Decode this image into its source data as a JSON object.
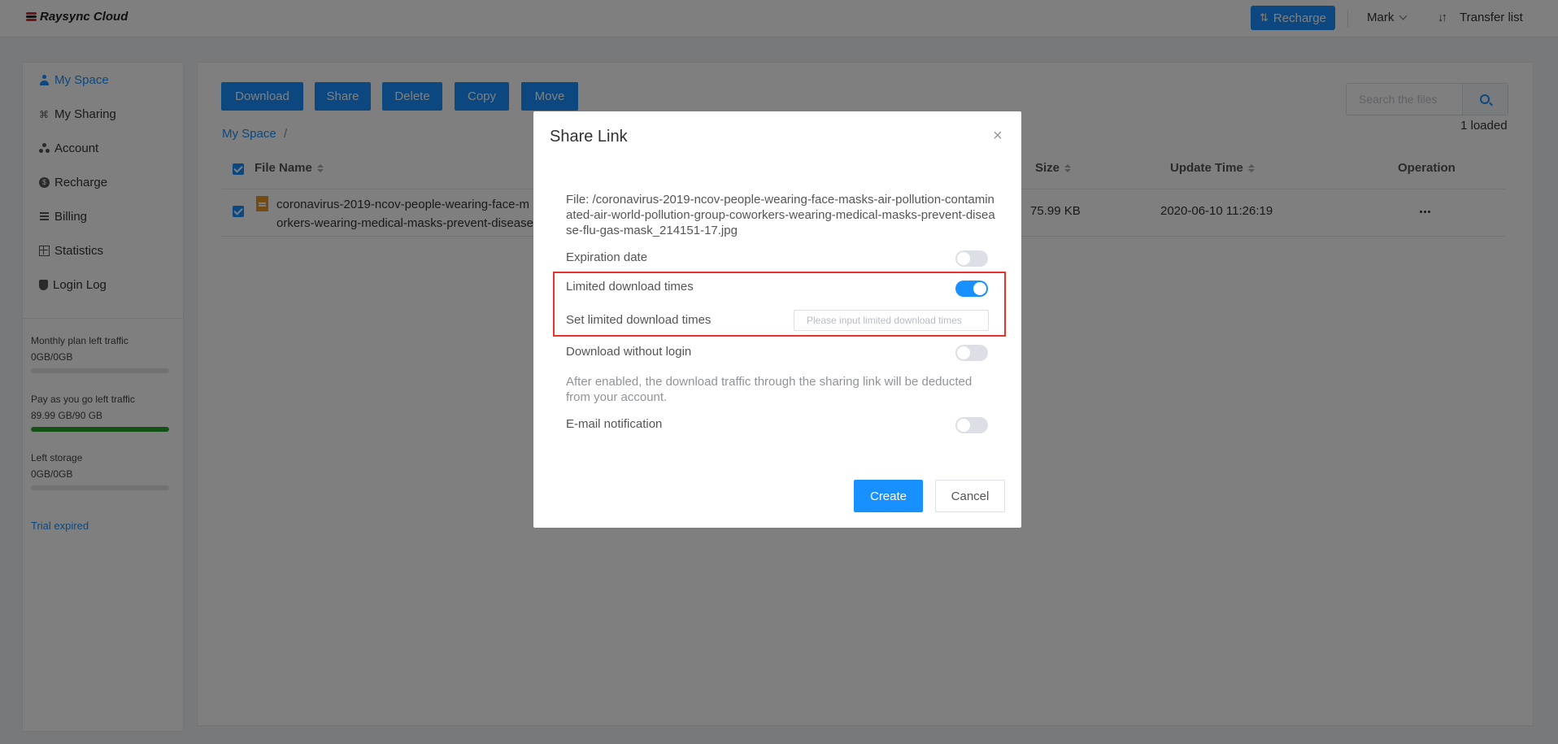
{
  "header": {
    "logo_text": "Raysync Cloud",
    "recharge_label": "Recharge",
    "user_name": "Mark",
    "transfer_label": "Transfer list"
  },
  "sidebar": {
    "items": [
      {
        "label": "My Space",
        "icon": "user-icon",
        "active": true
      },
      {
        "label": "My Sharing",
        "icon": "share-icon"
      },
      {
        "label": "Account",
        "icon": "account-icon"
      },
      {
        "label": "Recharge",
        "icon": "coin-icon"
      },
      {
        "label": "Billing",
        "icon": "billing-icon"
      },
      {
        "label": "Statistics",
        "icon": "statistics-icon"
      },
      {
        "label": "Login Log",
        "icon": "shield-icon"
      }
    ],
    "quotas": [
      {
        "label": "Monthly plan left traffic",
        "value": "0GB/0GB",
        "fraction": 0
      },
      {
        "label": "Pay as you go left traffic",
        "value": "89.99 GB/90 GB",
        "fraction": 1.0
      },
      {
        "label": "Left storage",
        "value": "0GB/0GB",
        "fraction": 0
      }
    ],
    "trial_text": "Trial expired"
  },
  "toolbar": {
    "download": "Download",
    "share": "Share",
    "delete": "Delete",
    "copy": "Copy",
    "move": "Move",
    "search_placeholder": "Search the files",
    "loaded_text": "1 loaded"
  },
  "breadcrumb": {
    "root": "My Space",
    "separator": "/"
  },
  "table": {
    "headers": {
      "name": "File Name",
      "size": "Size",
      "time": "Update Time",
      "operation": "Operation"
    },
    "rows": [
      {
        "name_line1": "coronavirus-2019-ncov-people-wearing-face-m",
        "name_line2": "orkers-wearing-medical-masks-prevent-disease",
        "size": "75.99 KB",
        "time": "2020-06-10 11:26:19",
        "checked": true
      }
    ]
  },
  "modal": {
    "title": "Share Link",
    "close_glyph": "×",
    "file_path": "File: /coronavirus-2019-ncov-people-wearing-face-masks-air-pollution-contaminated-air-world-pollution-group-coworkers-wearing-medical-masks-prevent-disease-flu-gas-mask_214151-17.jpg",
    "expiration_label": "Expiration date",
    "expiration_on": false,
    "limited_label": "Limited download times",
    "limited_on": true,
    "set_limited_label": "Set limited download times",
    "limited_placeholder": "Please input limited download times",
    "no_login_label": "Download without login",
    "no_login_on": false,
    "note": "After enabled, the download traffic through the sharing link will be deducted from your account.",
    "email_label": "E-mail notification",
    "email_on": false,
    "create_label": "Create",
    "cancel_label": "Cancel"
  },
  "colors": {
    "accent": "#1890ff",
    "highlight": "#e8322b",
    "success": "#27a127"
  }
}
